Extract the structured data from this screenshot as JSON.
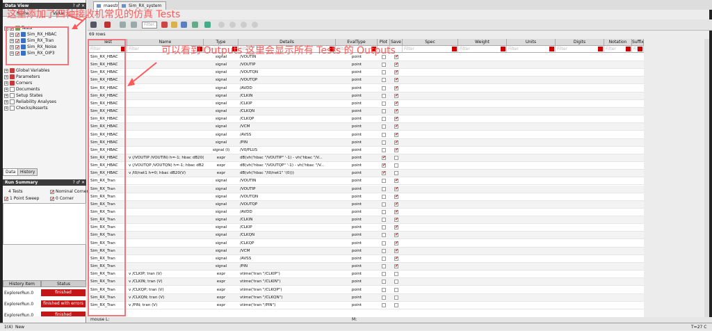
{
  "data_view": {
    "title": "Data View",
    "controls": "? ♂ ✕",
    "header": {
      "col1": "Name",
      "col2": "Value"
    },
    "tree": [
      {
        "label": "Tests",
        "indent": 0,
        "icon": "tests-icon"
      },
      {
        "label": "Sim_RX_HBAC",
        "indent": 1,
        "icon": "test-icon"
      },
      {
        "label": "Sim_RX_Tran",
        "indent": 1,
        "icon": "test-icon"
      },
      {
        "label": "Sim_RX_Noise",
        "indent": 1,
        "icon": "test-icon"
      },
      {
        "label": "Sim_RX_OIP3",
        "indent": 1,
        "icon": "test-icon"
      },
      {
        "label": "Global Variables",
        "indent": 0,
        "icon": "variables-icon"
      },
      {
        "label": "Parameters",
        "indent": 0,
        "icon": "parameters-icon"
      },
      {
        "label": "Corners",
        "indent": 0,
        "icon": "corners-icon"
      },
      {
        "label": "Documents",
        "indent": 0,
        "icon": "documents-icon"
      },
      {
        "label": "Setup States",
        "indent": 0,
        "icon": "setup-icon"
      },
      {
        "label": "Reliability Analyses",
        "indent": 0,
        "icon": "reliability-icon"
      },
      {
        "label": "Checks/Asserts",
        "indent": 0,
        "icon": "checks-icon"
      }
    ],
    "tabs": [
      "Data",
      "History"
    ]
  },
  "run_summary": {
    "title": "Run Summary",
    "controls": "? ♂ ✕",
    "tests": "4 Tests",
    "nominal": "Nominal Corner",
    "sweep": "1 Point Sweep",
    "corner": "0 Corner"
  },
  "history": {
    "col1": "History Item",
    "col2": "Status",
    "rows": [
      {
        "item": "ExplorerRun.0",
        "status": "finished"
      },
      {
        "item": "ExplorerRun.0",
        "status": "finished with errors"
      },
      {
        "item": "ExplorerRun.0",
        "status": "finished"
      }
    ]
  },
  "window_tabs": [
    "maestro",
    "Sim_RX_system"
  ],
  "toolbar": {
    "filter_placeholder": "Filter..."
  },
  "row_count": "69 rows",
  "columns": [
    "Test",
    "Name",
    "Type",
    "Details",
    "EvalType",
    "Plot",
    "Save",
    "Spec",
    "Weight",
    "Units",
    "Digits",
    "Notation",
    "Suffix"
  ],
  "filter_placeholder": "Filter",
  "outputs": [
    {
      "test": "Sim_RX_HBAC",
      "name": "",
      "type": "signal",
      "details": "/VOUTIN",
      "eval": "point",
      "plot": false,
      "save": true
    },
    {
      "test": "Sim_RX_HBAC",
      "name": "",
      "type": "signal",
      "details": "/VOUTIP",
      "eval": "point",
      "plot": false,
      "save": true
    },
    {
      "test": "Sim_RX_HBAC",
      "name": "",
      "type": "signal",
      "details": "/VOUTQN",
      "eval": "point",
      "plot": false,
      "save": true
    },
    {
      "test": "Sim_RX_HBAC",
      "name": "",
      "type": "signal",
      "details": "/VOUTQP",
      "eval": "point",
      "plot": false,
      "save": true
    },
    {
      "test": "Sim_RX_HBAC",
      "name": "",
      "type": "signal",
      "details": "/AVDD",
      "eval": "point",
      "plot": false,
      "save": true
    },
    {
      "test": "Sim_RX_HBAC",
      "name": "",
      "type": "signal",
      "details": "/CLKIN",
      "eval": "point",
      "plot": false,
      "save": true
    },
    {
      "test": "Sim_RX_HBAC",
      "name": "",
      "type": "signal",
      "details": "/CLKIP",
      "eval": "point",
      "plot": false,
      "save": true
    },
    {
      "test": "Sim_RX_HBAC",
      "name": "",
      "type": "signal",
      "details": "/CLKQN",
      "eval": "point",
      "plot": false,
      "save": true
    },
    {
      "test": "Sim_RX_HBAC",
      "name": "",
      "type": "signal",
      "details": "/CLKQP",
      "eval": "point",
      "plot": false,
      "save": true
    },
    {
      "test": "Sim_RX_HBAC",
      "name": "",
      "type": "signal",
      "details": "/VCM",
      "eval": "point",
      "plot": false,
      "save": true
    },
    {
      "test": "Sim_RX_HBAC",
      "name": "",
      "type": "signal",
      "details": "/AVSS",
      "eval": "point",
      "plot": false,
      "save": true
    },
    {
      "test": "Sim_RX_HBAC",
      "name": "",
      "type": "signal",
      "details": "/PIN",
      "eval": "point",
      "plot": false,
      "save": true
    },
    {
      "test": "Sim_RX_HBAC",
      "name": "",
      "type": "signal (I)",
      "details": "/V0/PLUS",
      "eval": "point",
      "plot": false,
      "save": true
    },
    {
      "test": "Sim_RX_HBAC",
      "name": "v (/VOUTIP /VOUTIN) h=-1; hbac dB20(V)",
      "type": "expr",
      "details": "dB(vh('hbac \"/VOUTIP\" '-1) - vh('hbac \"/V...",
      "eval": "point",
      "plot": true,
      "save": false
    },
    {
      "test": "Sim_RX_HBAC",
      "name": "v (/VOUTQP /VOUTQN) h=-1; hbac dB20(V)",
      "type": "expr",
      "details": "dB(vh('hbac \"/VOUTQP\" '-1) - vh('hbac \"/V...",
      "eval": "point",
      "plot": true,
      "save": false
    },
    {
      "test": "Sim_RX_HBAC",
      "name": "v /I0/net1 h=0; hbac dB20(V)",
      "type": "expr",
      "details": "dB(vh('hbac \"/I0/net1\" '(0)))",
      "eval": "point",
      "plot": true,
      "save": false
    },
    {
      "test": "Sim_RX_Tran",
      "name": "",
      "type": "signal",
      "details": "/VOUTIN",
      "eval": "point",
      "plot": false,
      "save": true
    },
    {
      "test": "Sim_RX_Tran",
      "name": "",
      "type": "signal",
      "details": "/VOUTIP",
      "eval": "point",
      "plot": false,
      "save": true
    },
    {
      "test": "Sim_RX_Tran",
      "name": "",
      "type": "signal",
      "details": "/VOUTQN",
      "eval": "point",
      "plot": false,
      "save": true
    },
    {
      "test": "Sim_RX_Tran",
      "name": "",
      "type": "signal",
      "details": "/VOUTQP",
      "eval": "point",
      "plot": false,
      "save": true
    },
    {
      "test": "Sim_RX_Tran",
      "name": "",
      "type": "signal",
      "details": "/AVDD",
      "eval": "point",
      "plot": false,
      "save": true
    },
    {
      "test": "Sim_RX_Tran",
      "name": "",
      "type": "signal",
      "details": "/CLKIN",
      "eval": "point",
      "plot": false,
      "save": true
    },
    {
      "test": "Sim_RX_Tran",
      "name": "",
      "type": "signal",
      "details": "/CLKIP",
      "eval": "point",
      "plot": false,
      "save": true
    },
    {
      "test": "Sim_RX_Tran",
      "name": "",
      "type": "signal",
      "details": "/CLKQN",
      "eval": "point",
      "plot": false,
      "save": true
    },
    {
      "test": "Sim_RX_Tran",
      "name": "",
      "type": "signal",
      "details": "/CLKQP",
      "eval": "point",
      "plot": false,
      "save": true
    },
    {
      "test": "Sim_RX_Tran",
      "name": "",
      "type": "signal",
      "details": "/VCM",
      "eval": "point",
      "plot": false,
      "save": true
    },
    {
      "test": "Sim_RX_Tran",
      "name": "",
      "type": "signal",
      "details": "/AVSS",
      "eval": "point",
      "plot": false,
      "save": true
    },
    {
      "test": "Sim_RX_Tran",
      "name": "",
      "type": "signal",
      "details": "/PIN",
      "eval": "point",
      "plot": false,
      "save": true
    },
    {
      "test": "Sim_RX_Tran",
      "name": "v /CLKIP; tran (V)",
      "type": "expr",
      "details": "vtime('tran \"/CLKIP\")",
      "eval": "point",
      "plot": false,
      "save": false
    },
    {
      "test": "Sim_RX_Tran",
      "name": "v /CLKIN; tran (V)",
      "type": "expr",
      "details": "vtime('tran \"/CLKIN\")",
      "eval": "point",
      "plot": false,
      "save": false
    },
    {
      "test": "Sim_RX_Tran",
      "name": "v /CLKQP; tran (V)",
      "type": "expr",
      "details": "vtime('tran \"/CLKQP\")",
      "eval": "point",
      "plot": false,
      "save": false
    },
    {
      "test": "Sim_RX_Tran",
      "name": "v /CLKQN; tran (V)",
      "type": "expr",
      "details": "vtime('tran \"/CLKQN\")",
      "eval": "point",
      "plot": false,
      "save": false
    },
    {
      "test": "Sim_RX_Tran",
      "name": "v /PIN; tran (V)",
      "type": "expr",
      "details": "vtime('tran \"/PIN\")",
      "eval": "point",
      "plot": false,
      "save": false
    }
  ],
  "status_bar": {
    "mouse": "mouse L:",
    "mid": "M:",
    "page": "1(4)",
    "mode": "New",
    "temp": "T=27 C"
  },
  "annotations": {
    "top": "这里添加了四种接收机常见的仿真 Tests",
    "mid": "可以看到 Outputs 这里会显示所有 Tests 的 Outputs"
  },
  "colors": {
    "accent_red": "#c41616",
    "annotation": "#ff5a5a"
  }
}
